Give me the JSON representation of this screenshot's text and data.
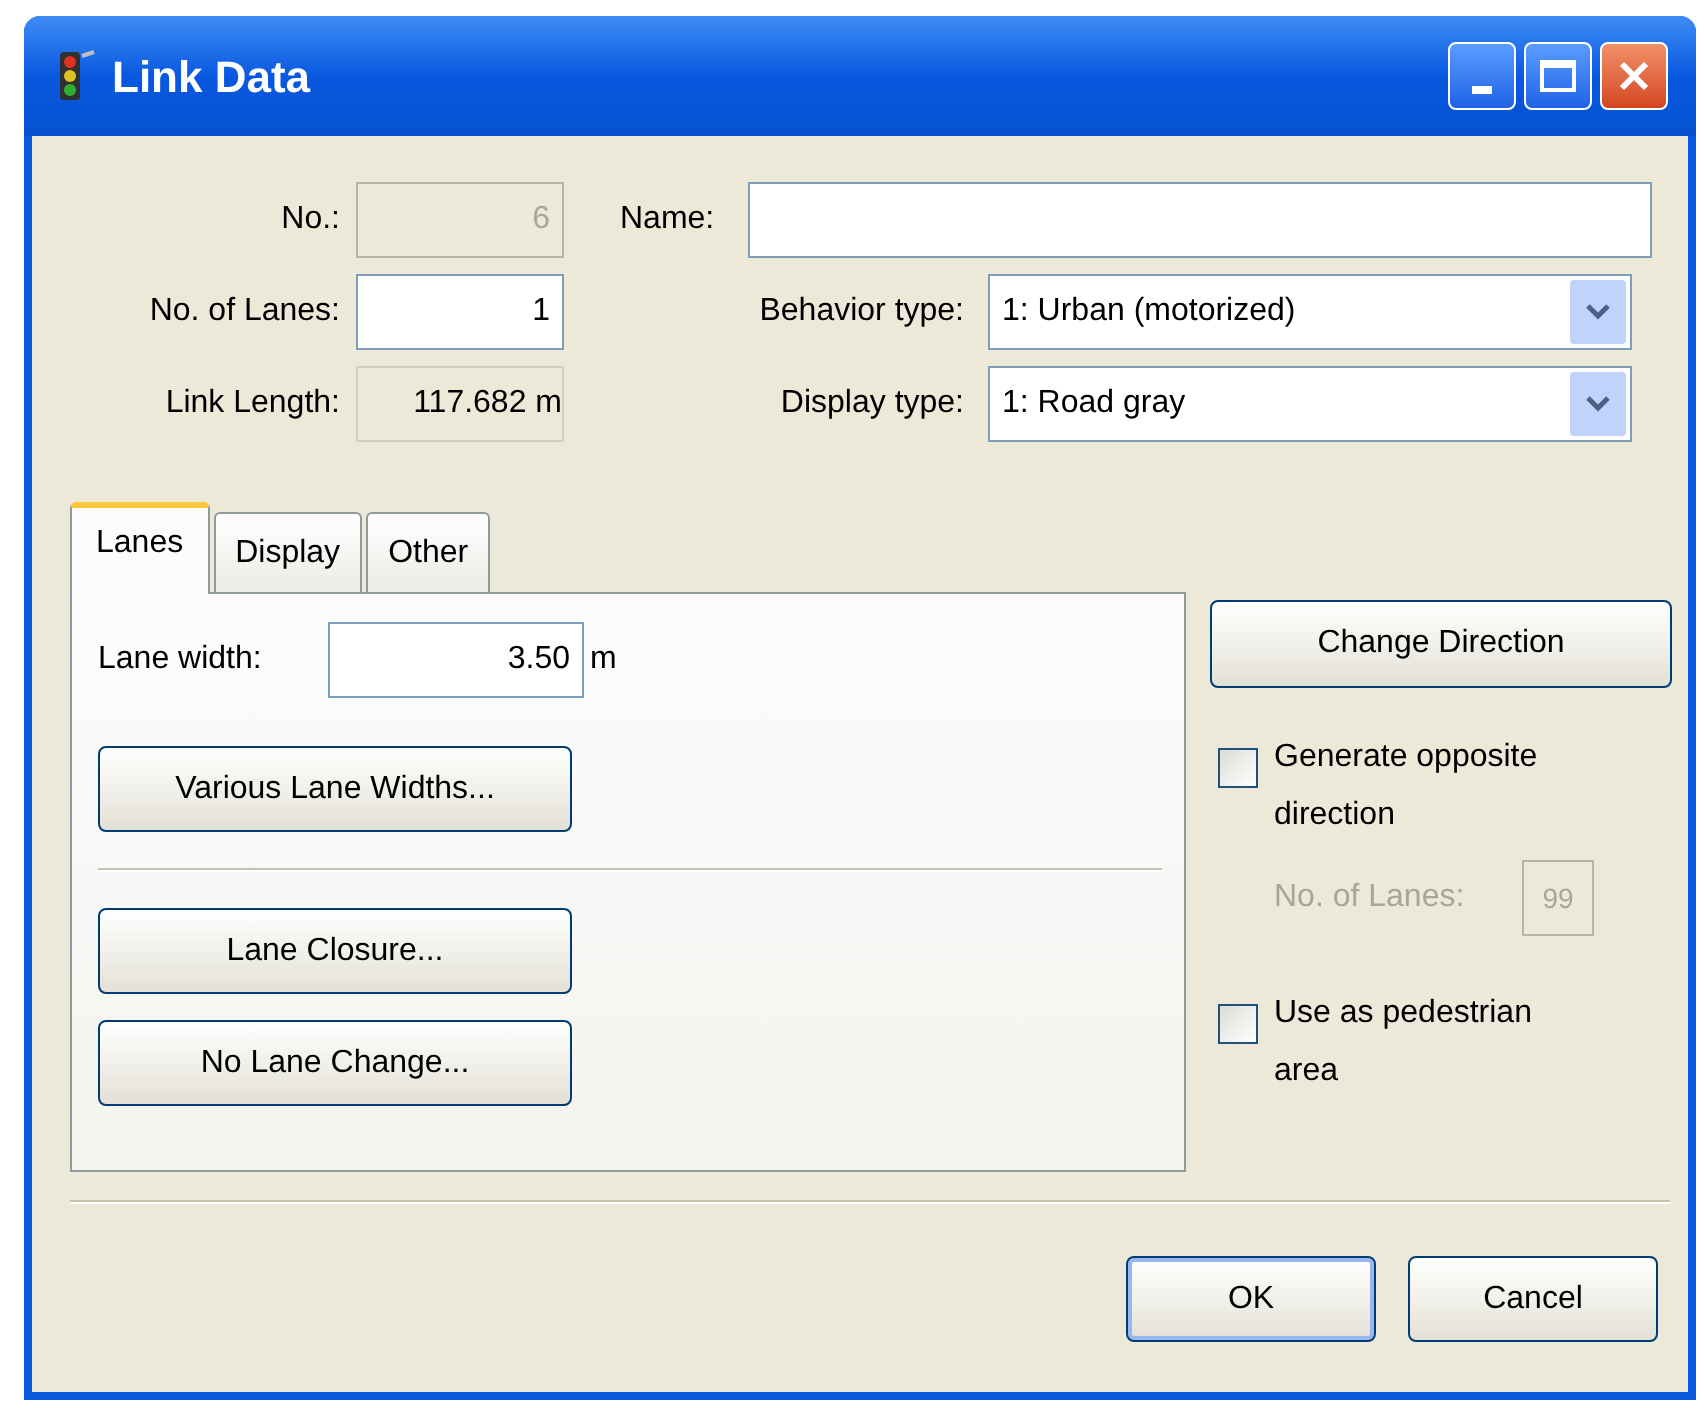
{
  "window": {
    "title": "Link Data"
  },
  "header": {
    "number": {
      "label": "No.:",
      "value": "6",
      "disabled": true
    },
    "name": {
      "label": "Name:"
    },
    "lanes": {
      "label": "No. of Lanes:",
      "value": "1",
      "disabled": false
    },
    "length": {
      "label": "Link Length:",
      "value": "117.682 m"
    },
    "behavior_type": {
      "label": "Behavior type:",
      "value": "1: Urban (motorized)"
    },
    "display_type": {
      "label": "Display type:",
      "value": "1: Road gray"
    }
  },
  "tabs": [
    {
      "label": "Lanes",
      "selected": true
    },
    {
      "label": "Display",
      "selected": false
    },
    {
      "label": "Other",
      "selected": false
    }
  ],
  "lanes_tab": {
    "lane_width": {
      "label": "Lane width:",
      "value": "3.50",
      "unit": "m"
    },
    "buttons": [
      {
        "label": "Various Lane Widths..."
      },
      {
        "label": "Lane Closure..."
      },
      {
        "label": "No Lane Change..."
      }
    ]
  },
  "side": {
    "change_direction": "Change Direction",
    "opposite": {
      "label": "Generate opposite direction",
      "checked": false
    },
    "opposite_lanes": {
      "label": "No. of Lanes:",
      "value": "99",
      "disabled": true
    },
    "pedestrian": {
      "label": "Use as pedestrian area",
      "checked": false
    }
  },
  "footer": [
    {
      "label": "OK",
      "default": true
    },
    {
      "label": "Cancel",
      "default": false
    }
  ]
}
